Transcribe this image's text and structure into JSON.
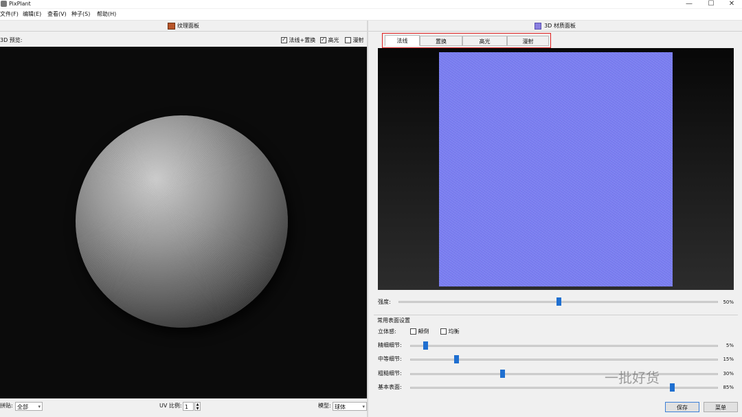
{
  "app": {
    "title": "PixPlant"
  },
  "window": {
    "minimize": "—",
    "maximize": "☐",
    "close": "✕"
  },
  "menu": [
    "文件(F)",
    "编辑(E)",
    "查看(V)",
    "种子(S)",
    "帮助(H)"
  ],
  "left_panel": {
    "header": "纹理面板",
    "preview_label": "3D 预览:",
    "checkboxes": [
      {
        "label": "法线+置换",
        "checked": true
      },
      {
        "label": "高光",
        "checked": true
      },
      {
        "label": "漫射",
        "checked": false
      }
    ],
    "bottom": {
      "map_label": "拼贴:",
      "map_value": "全部",
      "uv_label": "UV 比例:",
      "uv_value": "1",
      "model_label": "模型:",
      "model_value": "球体"
    }
  },
  "right_panel": {
    "header": "3D 材质面板",
    "tabs": [
      "法线",
      "置换",
      "高光",
      "漫射"
    ],
    "active_tab": "法线",
    "strength": {
      "label": "强度:",
      "value": "50%",
      "fraction": 0.5
    },
    "settings": {
      "title": "常用表面设置",
      "relief_label": "立体感:",
      "invert_label": "颠倒",
      "invert_checked": false,
      "balance_label": "均衡",
      "balance_checked": false,
      "sliders": [
        {
          "label": "精细细节:",
          "value": "5%",
          "fraction": 0.05
        },
        {
          "label": "中等细节:",
          "value": "15%",
          "fraction": 0.15
        },
        {
          "label": "粗糙细节:",
          "value": "30%",
          "fraction": 0.3
        },
        {
          "label": "基本表面:",
          "value": "85%",
          "fraction": 0.85
        }
      ]
    },
    "buttons": {
      "save": "保存",
      "menu": "菜单"
    }
  },
  "watermark": "一批好货",
  "colors": {
    "accent": "#1f6fd0",
    "tab_outline": "#e02020",
    "normal_map": "#7f83f0"
  }
}
